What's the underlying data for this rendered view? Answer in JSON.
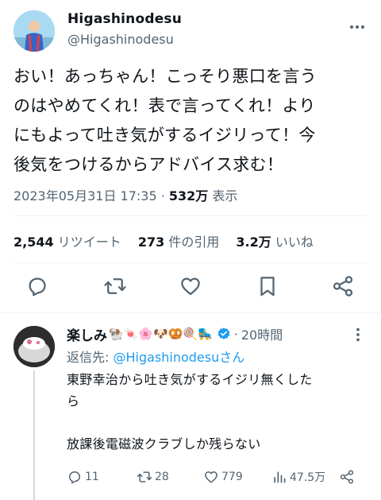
{
  "tweet": {
    "author_name": "Higashinodesu",
    "author_handle": "@Higashinodesu",
    "text_lines": [
      "おい！あっちゃん！こっそり悪口を言う",
      "のはやめてくれ！表で言ってくれ！より",
      "にもよって吐き気がするイジリって！今",
      "後気をつけるからアドバイス求む！"
    ],
    "timestamp": "2023年05月31日 17:35",
    "separator": " · ",
    "views_count": "532万",
    "views_label": " 表示",
    "stats": {
      "retweets_count": "2,544",
      "retweets_label": "リツイート",
      "quotes_count": "273",
      "quotes_label": "件の引用",
      "likes_count": "3.2万",
      "likes_label": "いいね"
    },
    "icons": {
      "more": "more-icon",
      "reply": "reply-icon",
      "retweet": "retweet-icon",
      "like": "like-icon",
      "bookmark": "bookmark-icon",
      "share": "share-icon"
    }
  },
  "reply": {
    "author_name": "楽しみ",
    "author_emojis": "🐏🍬🌸🐶🥨🍭🛼",
    "time_sep": "·",
    "time": "20時間",
    "reply_to_label": "返信先: ",
    "reply_to_handle": "@Higashinodesuさん",
    "text": "東野幸治から吐き気がするイジリ無くした\nら\n\n放課後電磁波クラブしか残らない",
    "actions": {
      "replies": "11",
      "retweets": "28",
      "likes": "779",
      "views": "47.5万"
    }
  },
  "colors": {
    "text": "#0f1419",
    "secondary": "#536471",
    "accent": "#1d9bf0",
    "divider": "#eff3f4"
  }
}
